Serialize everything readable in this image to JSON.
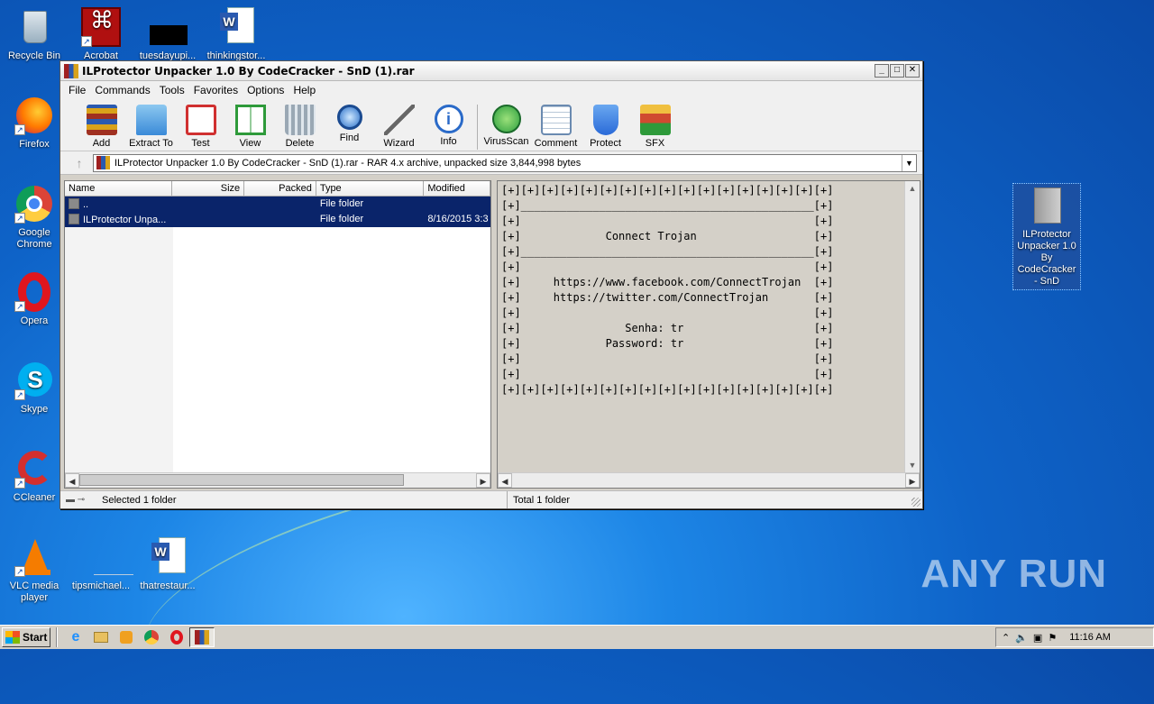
{
  "desktop": {
    "icons": [
      {
        "label": "Recycle Bin"
      },
      {
        "label": "Acrobat"
      },
      {
        "label": "tuesdayupi..."
      },
      {
        "label": "thinkingstor..."
      },
      {
        "label": "Firefox"
      },
      {
        "label": "Google Chrome"
      },
      {
        "label": "Opera"
      },
      {
        "label": "Skype"
      },
      {
        "label": "CCleaner"
      },
      {
        "label": "VLC media player"
      },
      {
        "label": "tipsmichael..."
      },
      {
        "label": "thatrestaur..."
      },
      {
        "label": "ILProtector Unpacker 1.0 By CodeCracker - SnD"
      }
    ]
  },
  "window": {
    "title": "ILProtector Unpacker 1.0 By CodeCracker - SnD (1).rar",
    "buttons": {
      "minimize": "_",
      "maximize": "□",
      "close": "✕"
    },
    "menu": [
      "File",
      "Commands",
      "Tools",
      "Favorites",
      "Options",
      "Help"
    ],
    "toolbar": [
      {
        "label": "Add",
        "icon": "add-archive-icon",
        "color": "#c8a040"
      },
      {
        "label": "Extract To",
        "icon": "extract-folder-icon",
        "color": "#3a8ad8"
      },
      {
        "label": "Test",
        "icon": "test-clipboard-icon",
        "color": "#d03030"
      },
      {
        "label": "View",
        "icon": "view-book-icon",
        "color": "#2e9a3a"
      },
      {
        "label": "Delete",
        "icon": "trash-icon",
        "color": "#7a8a96"
      },
      {
        "label": "Find",
        "icon": "magnifier-icon",
        "color": "#2a70c8"
      },
      {
        "label": "Wizard",
        "icon": "wand-icon",
        "color": "#9a9a9a"
      },
      {
        "label": "Info",
        "icon": "info-icon",
        "color": "#2a6ac8"
      },
      {
        "label": "VirusScan",
        "icon": "virus-scan-icon",
        "color": "#2ea040"
      },
      {
        "label": "Comment",
        "icon": "comment-icon",
        "color": "#6a8ab0"
      },
      {
        "label": "Protect",
        "icon": "shield-icon",
        "color": "#2a6ad8"
      },
      {
        "label": "SFX",
        "icon": "sfx-box-icon",
        "color": "#d04a30"
      }
    ],
    "address": "ILProtector Unpacker 1.0 By CodeCracker - SnD (1).rar - RAR 4.x archive, unpacked size 3,844,998 bytes",
    "columns": [
      "Name",
      "Size",
      "Packed",
      "Type",
      "Modified"
    ],
    "rows": [
      {
        "name": "..",
        "size": "",
        "packed": "",
        "type": "File folder",
        "modified": ""
      },
      {
        "name": "ILProtector Unpa...",
        "size": "",
        "packed": "",
        "type": "File folder",
        "modified": "8/16/2015 3:3"
      }
    ],
    "comment_lines": [
      "[+][+][+][+][+][+][+][+][+][+][+][+][+][+][+][+][+]",
      "[+]_____________________________________________[+]",
      "[+]                                             [+]",
      "[+]             Connect Trojan                  [+]",
      "[+]_____________________________________________[+]",
      "[+]                                             [+]",
      "[+]     https://www.facebook.com/ConnectTrojan  [+]",
      "[+]     https://twitter.com/ConnectTrojan       [+]",
      "[+]                                             [+]",
      "[+]                Senha: tr                    [+]",
      "[+]             Password: tr                    [+]",
      "[+]                                             [+]",
      "[+]                                             [+]",
      "[+][+][+][+][+][+][+][+][+][+][+][+][+][+][+][+][+]"
    ],
    "status_left": "Selected 1 folder",
    "status_right": "Total 1 folder"
  },
  "taskbar": {
    "start": "Start",
    "apps": [
      "ie-icon",
      "explorer-icon",
      "media-player-icon",
      "chrome-icon",
      "opera-icon",
      "winrar-icon"
    ],
    "clock": "11:16 AM"
  },
  "watermark": "ANY RUN"
}
